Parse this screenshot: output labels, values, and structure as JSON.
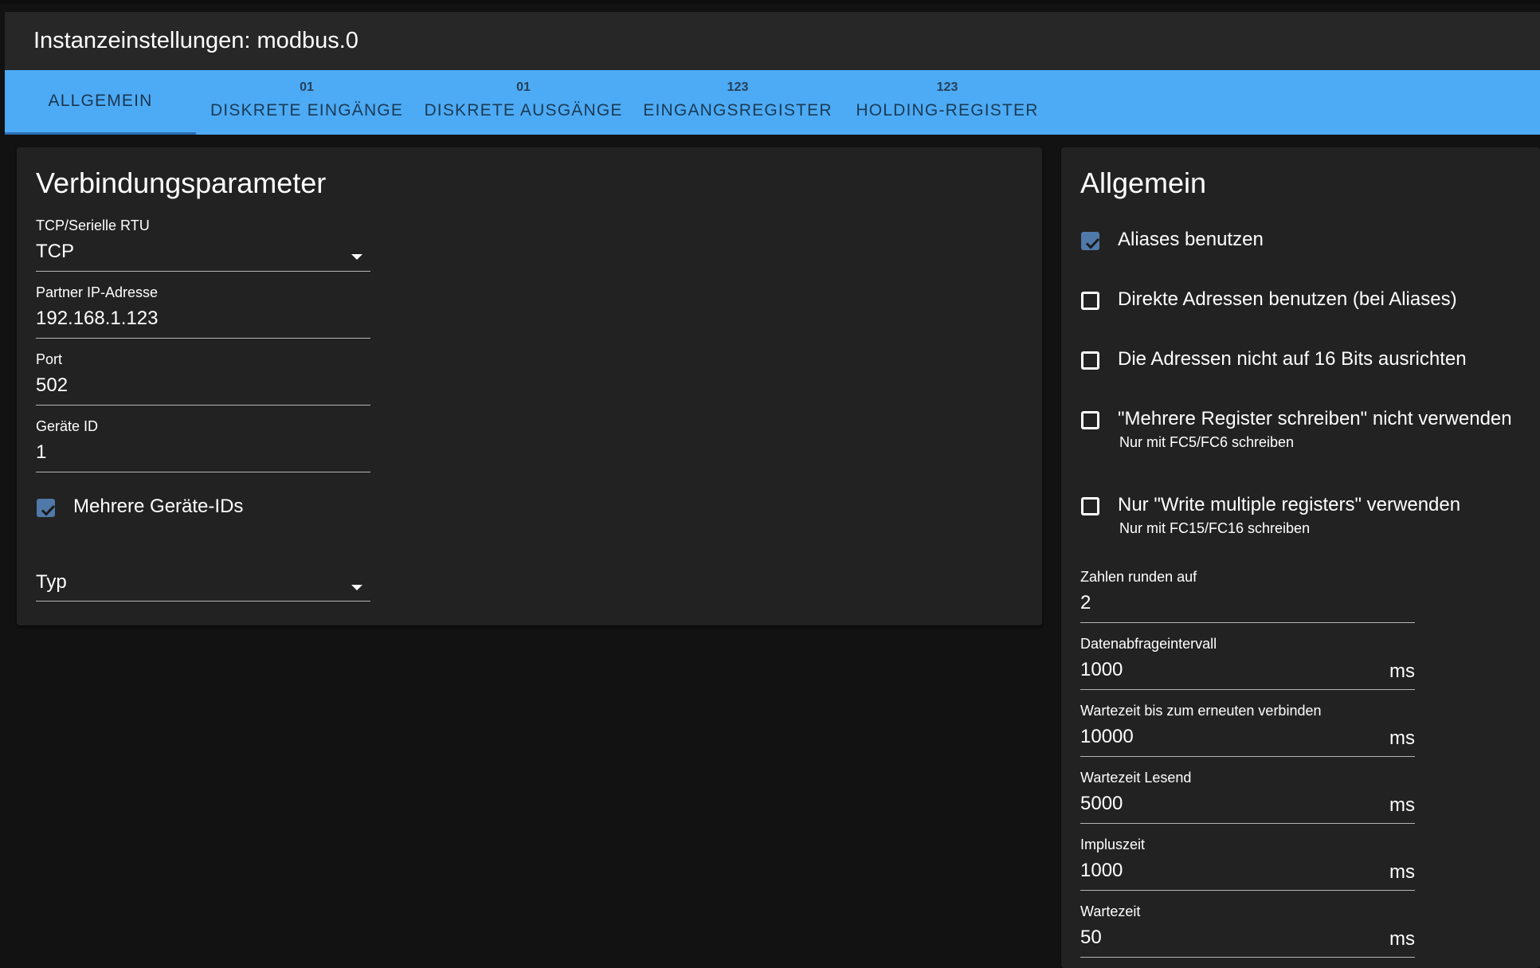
{
  "header": {
    "title": "Instanzeinstellungen: modbus.0"
  },
  "tabs": [
    {
      "label": "ALLGEMEIN",
      "icon": ""
    },
    {
      "label": "DISKRETE EINGÄNGE",
      "icon": "01"
    },
    {
      "label": "DISKRETE AUSGÄNGE",
      "icon": "01"
    },
    {
      "label": "EINGANGSREGISTER",
      "icon": "123"
    },
    {
      "label": "HOLDING-REGISTER",
      "icon": "123"
    }
  ],
  "connection": {
    "title": "Verbindungsparameter",
    "mode": {
      "label": "TCP/Serielle RTU",
      "value": "TCP"
    },
    "ip": {
      "label": "Partner IP-Adresse",
      "value": "192.168.1.123"
    },
    "port": {
      "label": "Port",
      "value": "502"
    },
    "device_id": {
      "label": "Geräte ID",
      "value": "1"
    },
    "multi_ids": {
      "label": "Mehrere Geräte-IDs",
      "checked": true
    },
    "type": {
      "value": "Typ"
    }
  },
  "general": {
    "title": "Allgemein",
    "options": [
      {
        "label": "Aliases benutzen",
        "sub": "",
        "checked": true
      },
      {
        "label": "Direkte Adressen benutzen (bei Aliases)",
        "sub": "",
        "checked": false
      },
      {
        "label": "Die Adressen nicht auf 16 Bits ausrichten",
        "sub": "",
        "checked": false
      },
      {
        "label": "\"Mehrere Register schreiben\" nicht verwenden",
        "sub": "Nur mit FC5/FC6 schreiben",
        "checked": false
      },
      {
        "label": "Nur \"Write multiple registers\" verwenden",
        "sub": "Nur mit FC15/FC16 schreiben",
        "checked": false
      }
    ],
    "fields": [
      {
        "label": "Zahlen runden auf",
        "value": "2",
        "unit": ""
      },
      {
        "label": "Datenabfrageintervall",
        "value": "1000",
        "unit": "ms"
      },
      {
        "label": "Wartezeit bis zum erneuten verbinden",
        "value": "10000",
        "unit": "ms"
      },
      {
        "label": "Wartezeit Lesend",
        "value": "5000",
        "unit": "ms"
      },
      {
        "label": "Impluszeit",
        "value": "1000",
        "unit": "ms"
      },
      {
        "label": "Wartezeit",
        "value": "50",
        "unit": "ms"
      }
    ]
  },
  "colors": {
    "accent": "#4dabf5",
    "checkbox": "#4f79a8",
    "background": "#121212",
    "card": "#222222"
  }
}
